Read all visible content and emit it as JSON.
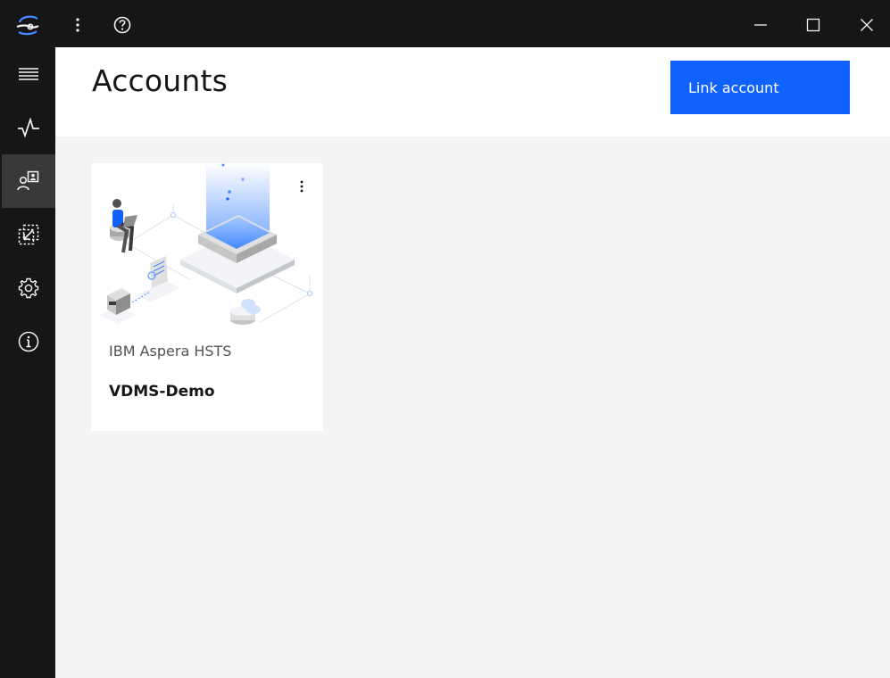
{
  "window": {
    "icons": {
      "app_logo": "aspera-logo-icon",
      "more": "overflow-menu-vertical-icon",
      "help": "help-icon",
      "minimize": "minimize-icon",
      "maximize": "maximize-icon",
      "close": "close-icon"
    }
  },
  "sidebar": {
    "items": [
      {
        "icon": "hamburger-menu-icon",
        "active": false
      },
      {
        "icon": "activity-icon",
        "active": false
      },
      {
        "icon": "accounts-icon",
        "active": true
      },
      {
        "icon": "transfer-icon",
        "active": false
      },
      {
        "icon": "settings-gear-icon",
        "active": false
      },
      {
        "icon": "information-icon",
        "active": false
      }
    ]
  },
  "header": {
    "title": "Accounts",
    "link_account_label": "Link account"
  },
  "accounts": [
    {
      "type": "IBM Aspera HSTS",
      "name": "VDMS-Demo"
    }
  ],
  "colors": {
    "primary_button": "#0f62fe",
    "sidebar_bg": "#161616",
    "sidebar_active": "#393939",
    "content_bg": "#f4f4f4",
    "card_bg": "#ffffff"
  }
}
